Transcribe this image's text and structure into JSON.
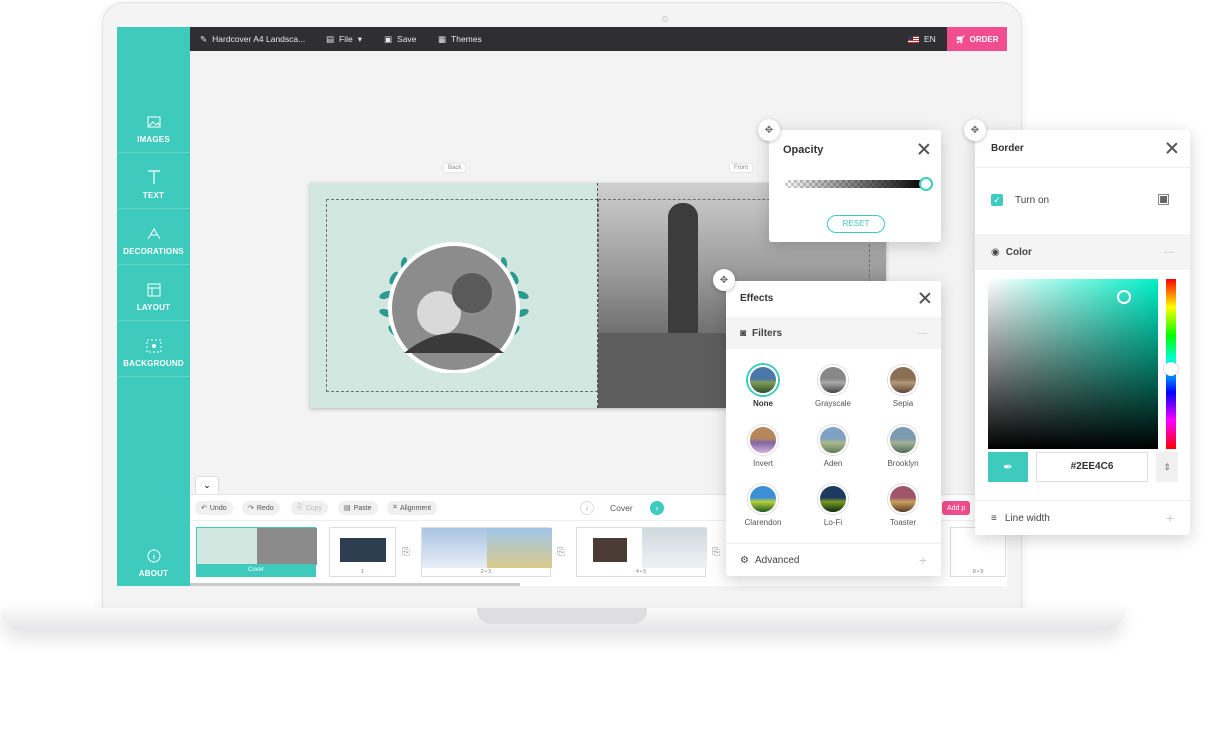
{
  "topbar": {
    "project": "Hardcover A4 Landsca...",
    "file": "File",
    "save": "Save",
    "themes": "Themes",
    "lang": "EN",
    "order": "ORDER"
  },
  "sidebar": {
    "items": [
      {
        "label": "IMAGES"
      },
      {
        "label": "TEXT"
      },
      {
        "label": "DECORATIONS"
      },
      {
        "label": "LAYOUT"
      },
      {
        "label": "BACKGROUND"
      }
    ],
    "about": "ABOUT"
  },
  "spread": {
    "back_label": "Back",
    "front_label": "Front"
  },
  "bottombar": {
    "undo": "Undo",
    "redo": "Redo",
    "copy": "Copy",
    "paste": "Paste",
    "alignment": "Alignment",
    "page": "Cover",
    "add_page": "Add p"
  },
  "thumbs": {
    "cover": "Cover",
    "p1": "1",
    "p23": "2 • 3",
    "p45": "4 • 5",
    "p89": "8 • 9"
  },
  "opacity": {
    "title": "Opacity",
    "reset": "RESET",
    "value": 1.0
  },
  "effects": {
    "title": "Effects",
    "filters_label": "Filters",
    "filters": [
      {
        "name": "None",
        "selected": true
      },
      {
        "name": "Grayscale"
      },
      {
        "name": "Sepia"
      },
      {
        "name": "Invert"
      },
      {
        "name": "Aden"
      },
      {
        "name": "Brooklyn"
      },
      {
        "name": "Clarendon"
      },
      {
        "name": "Lo-Fi"
      },
      {
        "name": "Toaster"
      }
    ],
    "advanced": "Advanced"
  },
  "border": {
    "title": "Border",
    "turn_on": "Turn on",
    "color_label": "Color",
    "hex": "#2EE4C6",
    "line_width": "Line width"
  },
  "colors": {
    "accent": "#3ecbbd",
    "order": "#f24e8f",
    "topbar": "#2f2f31",
    "picked": "#2EE4C6"
  }
}
